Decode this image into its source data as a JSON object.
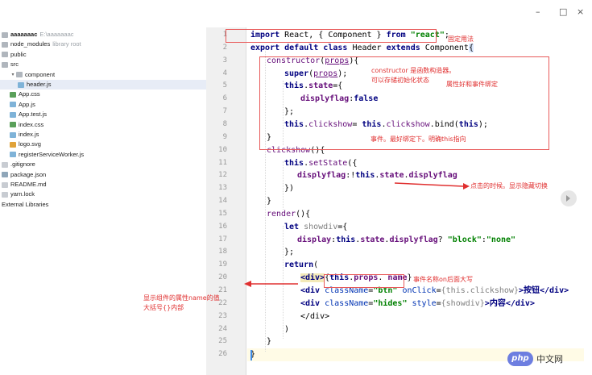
{
  "window": {
    "min": "–",
    "max": "□",
    "close": "×"
  },
  "tree": [
    {
      "label": "aaaaaaac",
      "path": "E:\\aaaaaaac",
      "kind": "folder",
      "indent": 0,
      "bold": true
    },
    {
      "label": "node_modules",
      "note": "library root",
      "kind": "folder",
      "indent": 0
    },
    {
      "label": "public",
      "kind": "folder",
      "indent": 0
    },
    {
      "label": "src",
      "kind": "folder",
      "indent": 0
    },
    {
      "label": "component",
      "kind": "folder",
      "indent": 1,
      "expanded": true
    },
    {
      "label": "header.js",
      "kind": "js",
      "indent": 2,
      "selected": true
    },
    {
      "label": "App.css",
      "kind": "css",
      "indent": 1
    },
    {
      "label": "App.js",
      "kind": "js",
      "indent": 1
    },
    {
      "label": "App.test.js",
      "kind": "js",
      "indent": 1
    },
    {
      "label": "index.css",
      "kind": "css",
      "indent": 1
    },
    {
      "label": "index.js",
      "kind": "js",
      "indent": 1
    },
    {
      "label": "logo.svg",
      "kind": "svg",
      "indent": 1
    },
    {
      "label": "registerServiceWorker.js",
      "kind": "js",
      "indent": 1
    },
    {
      "label": ".gitignore",
      "kind": "file",
      "indent": 0
    },
    {
      "label": "package.json",
      "kind": "json",
      "indent": 0
    },
    {
      "label": "README.md",
      "kind": "file",
      "indent": 0
    },
    {
      "label": "yarn.lock",
      "kind": "file",
      "indent": 0
    },
    {
      "label": "External Libraries",
      "kind": "lib",
      "indent": -1
    }
  ],
  "line_numbers": [
    "1",
    "2",
    "3",
    "4",
    "5",
    "6",
    "7",
    "8",
    "9",
    "10",
    "11",
    "12",
    "13",
    "14",
    "15",
    "16",
    "17",
    "18",
    "19",
    "20",
    "21",
    "22",
    "23",
    "24",
    "25",
    "26"
  ],
  "code": {
    "l1_a": "import",
    "l1_b": " React, { ",
    "l1_c": "Component",
    "l1_d": " } ",
    "l1_e": "from",
    "l1_f": "\"react\"",
    "l1_g": ";",
    "l2_a": "export default class",
    "l2_b": " Header ",
    "l2_c": "extends",
    "l2_d": " Component",
    "l2_e": "{",
    "l3_a": "constructor",
    "l3_b": "(",
    "l3_c": "props",
    "l3_d": "){",
    "l4_a": "super",
    "l4_b": "(",
    "l4_c": "props",
    "l4_d": ");",
    "l5_a": "this",
    "l5_b": ".",
    "l5_c": "state",
    "l5_d": "={",
    "l6_a": "displyflag",
    "l6_b": ":",
    "l6_c": "false",
    "l7": "};",
    "l8_a": "this",
    "l8_b": ".",
    "l8_c": "clickshow",
    "l8_d": "= ",
    "l8_e": "this",
    "l8_f": ".",
    "l8_g": "clickshow",
    "l8_h": ".bind(",
    "l8_i": "this",
    "l8_j": ");",
    "l9": "}",
    "l10_a": "clickshow",
    "l10_b": "(){",
    "l11_a": "this",
    "l11_b": ".",
    "l11_c": "setState",
    "l11_d": "({",
    "l12_a": "displyflag",
    "l12_b": ":!",
    "l12_c": "this",
    "l12_d": ".",
    "l12_e": "state",
    "l12_f": ".",
    "l12_g": "displyflag",
    "l13": "})",
    "l14": "}",
    "l15_a": "render",
    "l15_b": "(){",
    "l16_a": "let",
    "l16_b": " showdiv",
    "l16_c": "={",
    "l17_a": "display",
    "l17_b": ":",
    "l17_c": "this",
    "l17_d": ".",
    "l17_e": "state",
    "l17_f": ".",
    "l17_g": "displyflag",
    "l17_h": "? ",
    "l17_i": "\"block\"",
    "l17_j": ":",
    "l17_k": "\"none\"",
    "l18": "};",
    "l19_a": "return",
    "l19_b": "(",
    "l20_a": "<div>",
    "l20_b": "{",
    "l20_c": "this",
    "l20_d": ".",
    "l20_e": "props",
    "l20_f": ". ",
    "l20_g": "name",
    "l20_h": "}",
    "l21_a": "<div ",
    "l21_b": "className",
    "l21_c": "=",
    "l21_d": "\"btn\"",
    "l21_e": " onClick",
    "l21_f": "=",
    "l21_g": "{this.clickshow}",
    "l21_h": ">按钮</div>",
    "l22_a": "<div ",
    "l22_b": "className",
    "l22_c": "=",
    "l22_d": "\"hides\"",
    "l22_e": " style",
    "l22_f": "=",
    "l22_g": "{showdiv}",
    "l22_h": ">内容</div>",
    "l23": "</div>",
    "l24": ")",
    "l25": "}",
    "l26": "}"
  },
  "annotations": {
    "fixed_usage": "固定用法",
    "constructor_1": "constructor 是函数构造器。",
    "constructor_2": "可以存储初始化状态",
    "bind_events": "属性好和事件绑定",
    "event_bind": "事件。最好绑定下。明确this指向",
    "toggle": "点击的时候。显示隐藏切换",
    "event_name": "事件名称on后面大写",
    "props_1": "显示组件的属性name的值",
    "props_2": "大括号{}内部"
  },
  "watermark": {
    "logo": "php",
    "text": "中文网"
  }
}
